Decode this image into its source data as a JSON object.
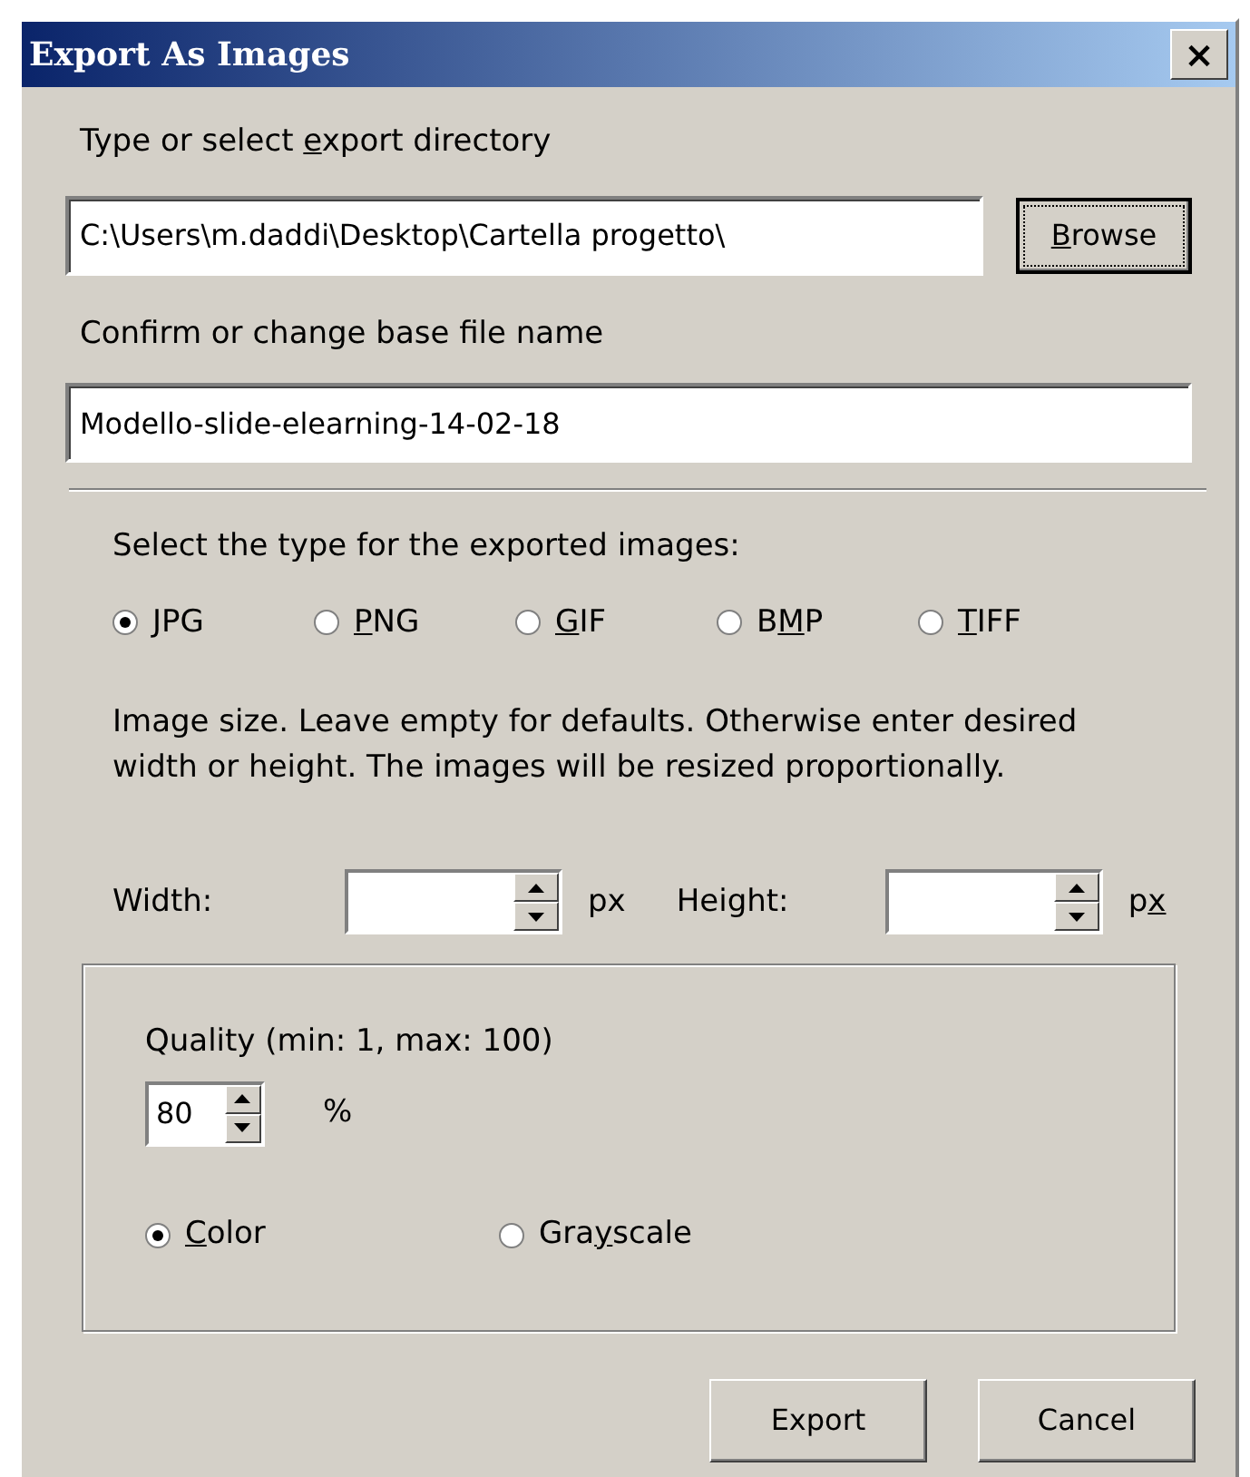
{
  "window": {
    "title": "Export As Images",
    "close": "×"
  },
  "directory": {
    "label": {
      "pre": "Type or select ",
      "key": "e",
      "post": "xport directory"
    },
    "value": "C:\\Users\\m.daddi\\Desktop\\Cartella progetto\\",
    "browse": {
      "key": "B",
      "post": "rowse",
      "focused": true
    }
  },
  "base_name": {
    "label": "Confirm or change base file name",
    "value": "Modello-slide-elearning-14-02-18"
  },
  "type": {
    "label": "Select the type for the exported images:",
    "options": [
      {
        "key": "J",
        "post": "PG",
        "selected": true
      },
      {
        "key": "P",
        "post": "NG",
        "selected": false
      },
      {
        "key": "G",
        "post": "IF",
        "selected": false
      },
      {
        "pre": "B",
        "key": "M",
        "post": "P",
        "selected": false
      },
      {
        "key": "T",
        "post": "IFF",
        "selected": false
      }
    ]
  },
  "size": {
    "note": "Image size. Leave empty for defaults. Otherwise enter desired width or height. The images will be resized proportionally.",
    "width_label": "Width:",
    "width_unit": {
      "pre": "px"
    },
    "height_label": "Height:",
    "height_unit": {
      "pre": "p",
      "key": "x"
    }
  },
  "quality": {
    "label": "Quality (min: 1, max: 100)",
    "value": "80",
    "unit": "%",
    "modes": [
      {
        "key": "C",
        "post": "olor",
        "selected": true
      },
      {
        "pre": "Gra",
        "key": "y",
        "post": "scale",
        "selected": false
      }
    ]
  },
  "buttons": [
    "Export",
    "Cancel"
  ]
}
